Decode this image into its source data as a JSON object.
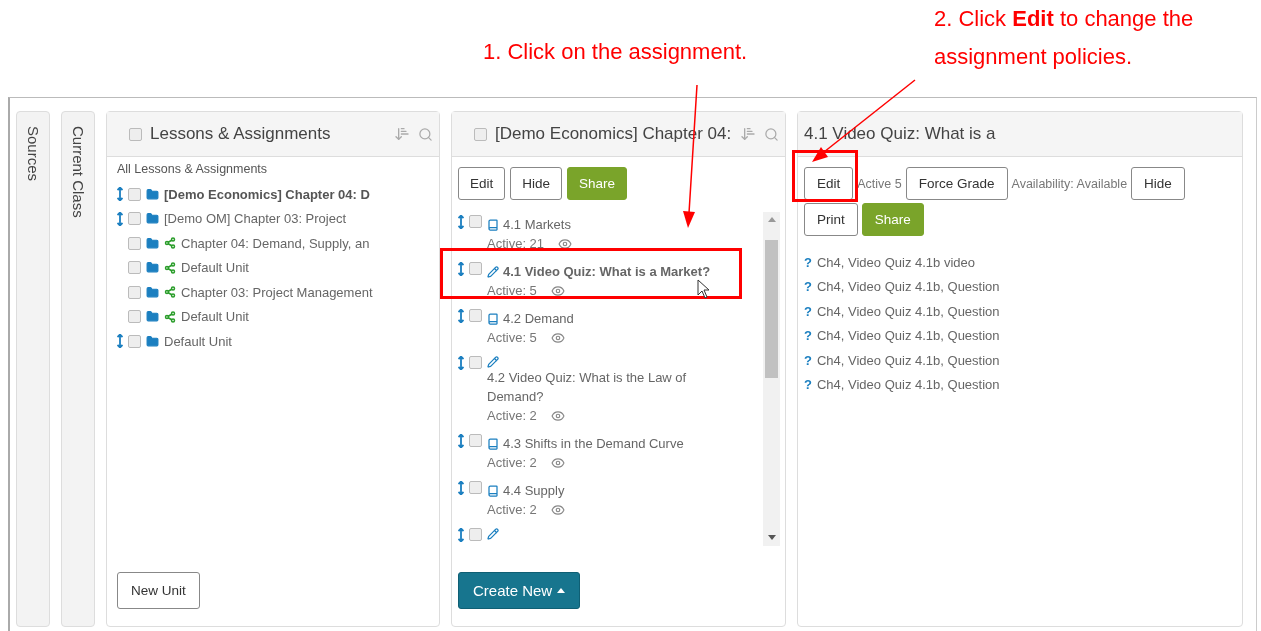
{
  "annotations": [
    {
      "text": "1. Click on the assignment."
    },
    {
      "text": "2. Click **Edit** to change the assignment policies."
    }
  ],
  "side_tabs": [
    {
      "label": "Sources"
    },
    {
      "label": "Current Class"
    }
  ],
  "lessons_panel": {
    "title": "Lessons & Assignments",
    "checked": false,
    "root_label": "All Lessons & Assignments",
    "items": [
      {
        "label": "[Demo Economics] Chapter 04: D",
        "selected": true,
        "checked": false,
        "shared": false
      },
      {
        "label": "[Demo OM] Chapter 03: Project",
        "selected": false,
        "checked": false,
        "shared": false,
        "children": [
          {
            "label": "Chapter 04: Demand, Supply, an",
            "selected": false,
            "checked": false,
            "shared": true
          },
          {
            "label": "Default Unit",
            "selected": false,
            "checked": false,
            "shared": true
          },
          {
            "label": "Chapter 03: Project Management",
            "selected": false,
            "checked": false,
            "shared": true
          },
          {
            "label": "Default Unit",
            "selected": false,
            "checked": false,
            "shared": true
          }
        ]
      },
      {
        "label": "Default Unit",
        "selected": false,
        "checked": false,
        "shared": false
      }
    ],
    "button": "New Unit"
  },
  "assignments_panel": {
    "title": "[Demo Economics] Chapter 04:",
    "checked": false,
    "buttons": [
      {
        "label": "Edit",
        "kind": "default"
      },
      {
        "label": "Hide",
        "kind": "default"
      },
      {
        "label": "Share",
        "kind": "primary"
      }
    ],
    "items": [
      {
        "kind": "reading",
        "title": "4.1 Markets",
        "active": "Active: 21",
        "selected": false,
        "checked": false
      },
      {
        "kind": "quiz",
        "title": "4.1 Video Quiz: What is a Market?",
        "active": "Active: 5",
        "selected": true,
        "checked": false
      },
      {
        "kind": "reading",
        "title": "4.2 Demand",
        "active": "Active: 5",
        "selected": false,
        "checked": false
      },
      {
        "kind": "quiz",
        "title": "4.2 Video Quiz: What is the Law of Demand?",
        "active": "Active: 2",
        "selected": false,
        "checked": false
      },
      {
        "kind": "reading",
        "title": "4.3 Shifts in the Demand Curve",
        "active": "Active: 2",
        "selected": false,
        "checked": false
      },
      {
        "kind": "reading",
        "title": "4.4 Supply",
        "active": "Active: 2",
        "selected": false,
        "checked": false
      },
      {
        "kind": "quiz",
        "checked": false
      }
    ],
    "create_button": "Create New"
  },
  "detail_panel": {
    "title": "4.1 Video Quiz: What is a",
    "toolbar": [
      {
        "kind": "button",
        "text": "Edit"
      },
      {
        "kind": "label",
        "text": "Active 5"
      },
      {
        "kind": "button",
        "text": "Force Grade"
      },
      {
        "kind": "label",
        "text": "Availability: Available"
      },
      {
        "kind": "button",
        "text": "Hide"
      },
      {
        "kind": "button",
        "text": "Print"
      },
      {
        "kind": "primary",
        "text": "Share"
      }
    ],
    "questions": [
      {
        "icon": "?",
        "text": "Ch4, Video Quiz 4.1b video"
      },
      {
        "icon": "?",
        "text": "Ch4, Video Quiz 4.1b, Question"
      },
      {
        "icon": "?",
        "text": "Ch4, Video Quiz 4.1b, Question"
      },
      {
        "icon": "?",
        "text": "Ch4, Video Quiz 4.1b, Question"
      },
      {
        "icon": "?",
        "text": "Ch4, Video Quiz 4.1b, Question"
      },
      {
        "icon": "?",
        "text": "Ch4, Video Quiz 4.1b, Question"
      }
    ]
  }
}
